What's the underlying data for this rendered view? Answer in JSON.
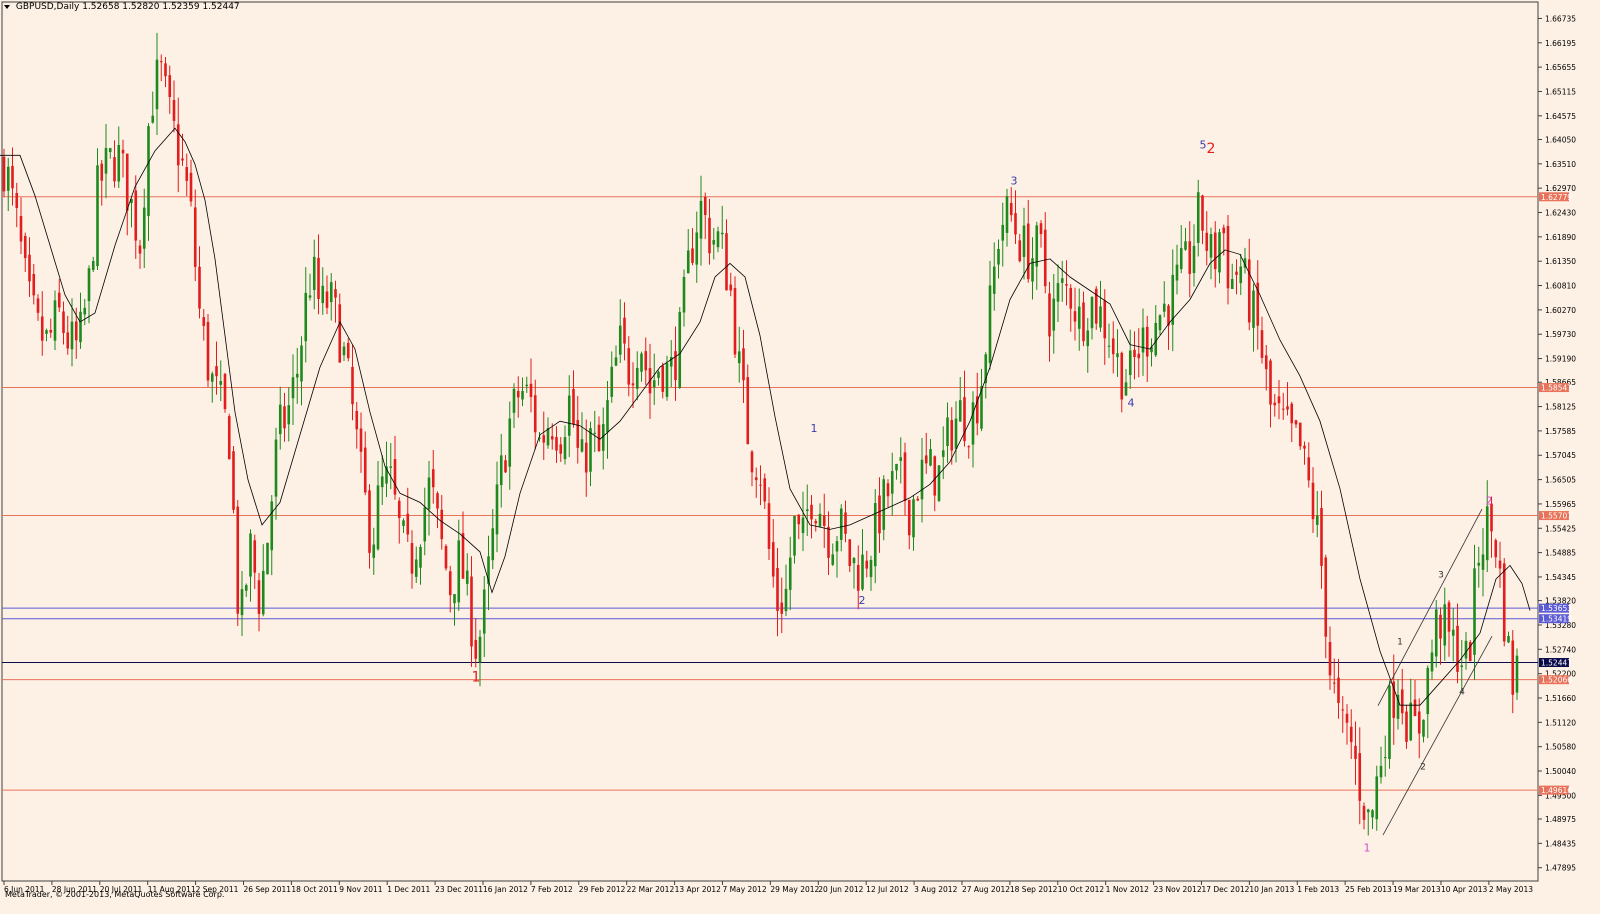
{
  "header": {
    "symbol": "GBPUSD,Daily",
    "ohlc": "1.52658 1.52820 1.52359 1.52447"
  },
  "footer": {
    "copyright": "MetaTrader, © 2001-2013, MetaQuotes Software Corp."
  },
  "colors": {
    "background": "#fdf0e4",
    "bull": "#1e8a1e",
    "bear": "#e11d1d",
    "level_line": "#e8735a",
    "channel_line": "#5b5bd6",
    "ma": "#000000",
    "wave_red": "#e11d1d",
    "wave_blue": "#3b3bb0",
    "wave_magenta": "#d34fd3"
  },
  "chart_data": {
    "type": "candlestick",
    "symbol": "GBPUSD",
    "timeframe": "Daily",
    "y_range": [
      1.476,
      1.671
    ],
    "y_ticks": [
      "1.66735",
      "1.66195",
      "1.65655",
      "1.65115",
      "1.64575",
      "1.64050",
      "1.63510",
      "1.62970",
      "1.62430",
      "1.61890",
      "1.61350",
      "1.60810",
      "1.60270",
      "1.59730",
      "1.59190",
      "1.58665",
      "1.58125",
      "1.57585",
      "1.57045",
      "1.56505",
      "1.55965",
      "1.55425",
      "1.54885",
      "1.54345",
      "1.53820",
      "1.53280",
      "1.52740",
      "1.52200",
      "1.51660",
      "1.51120",
      "1.50580",
      "1.50040",
      "1.49500",
      "1.48975",
      "1.48435",
      "1.47895"
    ],
    "x_ticks": [
      "6 Jun 2011",
      "28 Jun 2011",
      "20 Jul 2011",
      "11 Aug 2011",
      "2 Sep 2011",
      "26 Sep 2011",
      "18 Oct 2011",
      "9 Nov 2011",
      "1 Dec 2011",
      "23 Dec 2011",
      "16 Jan 2012",
      "7 Feb 2012",
      "29 Feb 2012",
      "22 Mar 2012",
      "13 Apr 2012",
      "7 May 2012",
      "29 May 2012",
      "20 Jun 2012",
      "12 Jul 2012",
      "3 Aug 2012",
      "27 Aug 2012",
      "18 Sep 2012",
      "10 Oct 2012",
      "1 Nov 2012",
      "23 Nov 2012",
      "17 Dec 2012",
      "10 Jan 2013",
      "1 Feb 2013",
      "25 Feb 2013",
      "19 Mar 2013",
      "10 Apr 2013",
      "2 May 2013"
    ],
    "close_path": [
      [
        0,
        1.638
      ],
      [
        8,
        1.632
      ],
      [
        18,
        1.62
      ],
      [
        28,
        1.605
      ],
      [
        38,
        1.598
      ],
      [
        48,
        1.595
      ],
      [
        58,
        1.602
      ],
      [
        68,
        1.596
      ],
      [
        78,
        1.594
      ],
      [
        88,
        1.606
      ],
      [
        98,
        1.63
      ],
      [
        108,
        1.635
      ],
      [
        118,
        1.637
      ],
      [
        130,
        1.627
      ],
      [
        140,
        1.618
      ],
      [
        150,
        1.648
      ],
      [
        160,
        1.656
      ],
      [
        170,
        1.645
      ],
      [
        180,
        1.637
      ],
      [
        190,
        1.626
      ],
      [
        200,
        1.601
      ],
      [
        210,
        1.588
      ],
      [
        220,
        1.582
      ],
      [
        230,
        1.574
      ],
      [
        236,
        1.545
      ],
      [
        240,
        1.531
      ],
      [
        250,
        1.55
      ],
      [
        260,
        1.538
      ],
      [
        268,
        1.553
      ],
      [
        278,
        1.575
      ],
      [
        288,
        1.58
      ],
      [
        298,
        1.59
      ],
      [
        305,
        1.603
      ],
      [
        312,
        1.612
      ],
      [
        320,
        1.603
      ],
      [
        330,
        1.605
      ],
      [
        338,
        1.599
      ],
      [
        346,
        1.59
      ],
      [
        354,
        1.578
      ],
      [
        362,
        1.564
      ],
      [
        372,
        1.551
      ],
      [
        380,
        1.563
      ],
      [
        390,
        1.565
      ],
      [
        400,
        1.553
      ],
      [
        410,
        1.546
      ],
      [
        420,
        1.555
      ],
      [
        430,
        1.564
      ],
      [
        440,
        1.552
      ],
      [
        450,
        1.541
      ],
      [
        460,
        1.548
      ],
      [
        468,
        1.538
      ],
      [
        476,
        1.528
      ],
      [
        482,
        1.532
      ],
      [
        490,
        1.547
      ],
      [
        500,
        1.565
      ],
      [
        510,
        1.578
      ],
      [
        520,
        1.585
      ],
      [
        530,
        1.583
      ],
      [
        540,
        1.573
      ],
      [
        550,
        1.579
      ],
      [
        560,
        1.575
      ],
      [
        570,
        1.583
      ],
      [
        580,
        1.567
      ],
      [
        590,
        1.574
      ],
      [
        600,
        1.57
      ],
      [
        610,
        1.584
      ],
      [
        620,
        1.595
      ],
      [
        630,
        1.589
      ],
      [
        640,
        1.597
      ],
      [
        650,
        1.585
      ],
      [
        660,
        1.591
      ],
      [
        670,
        1.588
      ],
      [
        680,
        1.597
      ],
      [
        690,
        1.615
      ],
      [
        700,
        1.626
      ],
      [
        710,
        1.619
      ],
      [
        720,
        1.618
      ],
      [
        730,
        1.608
      ],
      [
        740,
        1.588
      ],
      [
        750,
        1.572
      ],
      [
        760,
        1.568
      ],
      [
        770,
        1.547
      ],
      [
        778,
        1.537
      ],
      [
        786,
        1.54
      ],
      [
        794,
        1.555
      ],
      [
        802,
        1.55
      ],
      [
        810,
        1.562
      ],
      [
        820,
        1.559
      ],
      [
        830,
        1.552
      ],
      [
        840,
        1.555
      ],
      [
        850,
        1.547
      ],
      [
        860,
        1.545
      ],
      [
        870,
        1.55
      ],
      [
        880,
        1.558
      ],
      [
        890,
        1.563
      ],
      [
        900,
        1.565
      ],
      [
        910,
        1.558
      ],
      [
        920,
        1.566
      ],
      [
        930,
        1.567
      ],
      [
        940,
        1.566
      ],
      [
        950,
        1.576
      ],
      [
        960,
        1.58
      ],
      [
        970,
        1.578
      ],
      [
        980,
        1.585
      ],
      [
        990,
        1.603
      ],
      [
        1000,
        1.622
      ],
      [
        1010,
        1.624
      ],
      [
        1020,
        1.618
      ],
      [
        1030,
        1.614
      ],
      [
        1040,
        1.617
      ],
      [
        1050,
        1.601
      ],
      [
        1060,
        1.607
      ],
      [
        1070,
        1.607
      ],
      [
        1080,
        1.6
      ],
      [
        1090,
        1.605
      ],
      [
        1100,
        1.602
      ],
      [
        1110,
        1.597
      ],
      [
        1120,
        1.589
      ],
      [
        1130,
        1.588
      ],
      [
        1140,
        1.595
      ],
      [
        1150,
        1.598
      ],
      [
        1160,
        1.602
      ],
      [
        1170,
        1.605
      ],
      [
        1180,
        1.61
      ],
      [
        1190,
        1.614
      ],
      [
        1200,
        1.625
      ],
      [
        1206,
        1.618
      ],
      [
        1214,
        1.613
      ],
      [
        1222,
        1.623
      ],
      [
        1230,
        1.608
      ],
      [
        1240,
        1.613
      ],
      [
        1250,
        1.604
      ],
      [
        1260,
        1.596
      ],
      [
        1270,
        1.581
      ],
      [
        1280,
        1.578
      ],
      [
        1290,
        1.575
      ],
      [
        1300,
        1.572
      ],
      [
        1310,
        1.562
      ],
      [
        1320,
        1.55
      ],
      [
        1330,
        1.523
      ],
      [
        1340,
        1.51
      ],
      [
        1350,
        1.508
      ],
      [
        1360,
        1.497
      ],
      [
        1370,
        1.488
      ],
      [
        1378,
        1.5
      ],
      [
        1388,
        1.513
      ],
      [
        1398,
        1.521
      ],
      [
        1408,
        1.511
      ],
      [
        1418,
        1.509
      ],
      [
        1428,
        1.522
      ],
      [
        1438,
        1.535
      ],
      [
        1448,
        1.53
      ],
      [
        1458,
        1.527
      ],
      [
        1468,
        1.524
      ],
      [
        1478,
        1.548
      ],
      [
        1488,
        1.556
      ],
      [
        1496,
        1.551
      ],
      [
        1504,
        1.535
      ],
      [
        1512,
        1.52
      ],
      [
        1518,
        1.524
      ]
    ],
    "moving_average_path": [
      [
        0,
        1.637
      ],
      [
        20,
        1.637
      ],
      [
        35,
        1.628
      ],
      [
        50,
        1.617
      ],
      [
        65,
        1.606
      ],
      [
        80,
        1.6
      ],
      [
        95,
        1.602
      ],
      [
        115,
        1.617
      ],
      [
        135,
        1.63
      ],
      [
        155,
        1.638
      ],
      [
        175,
        1.643
      ],
      [
        185,
        1.64
      ],
      [
        195,
        1.635
      ],
      [
        205,
        1.627
      ],
      [
        215,
        1.614
      ],
      [
        225,
        1.597
      ],
      [
        235,
        1.58
      ],
      [
        248,
        1.565
      ],
      [
        262,
        1.555
      ],
      [
        280,
        1.56
      ],
      [
        300,
        1.575
      ],
      [
        320,
        1.59
      ],
      [
        340,
        1.6
      ],
      [
        355,
        1.594
      ],
      [
        370,
        1.58
      ],
      [
        385,
        1.568
      ],
      [
        400,
        1.562
      ],
      [
        420,
        1.56
      ],
      [
        440,
        1.556
      ],
      [
        460,
        1.553
      ],
      [
        480,
        1.549
      ],
      [
        492,
        1.54
      ],
      [
        505,
        1.548
      ],
      [
        520,
        1.562
      ],
      [
        540,
        1.575
      ],
      [
        560,
        1.578
      ],
      [
        580,
        1.577
      ],
      [
        600,
        1.574
      ],
      [
        620,
        1.578
      ],
      [
        640,
        1.584
      ],
      [
        660,
        1.59
      ],
      [
        680,
        1.593
      ],
      [
        700,
        1.6
      ],
      [
        715,
        1.61
      ],
      [
        730,
        1.613
      ],
      [
        745,
        1.61
      ],
      [
        760,
        1.597
      ],
      [
        775,
        1.579
      ],
      [
        790,
        1.563
      ],
      [
        810,
        1.555
      ],
      [
        830,
        1.554
      ],
      [
        850,
        1.555
      ],
      [
        870,
        1.557
      ],
      [
        890,
        1.559
      ],
      [
        910,
        1.561
      ],
      [
        930,
        1.564
      ],
      [
        950,
        1.569
      ],
      [
        970,
        1.578
      ],
      [
        990,
        1.59
      ],
      [
        1010,
        1.605
      ],
      [
        1030,
        1.613
      ],
      [
        1050,
        1.614
      ],
      [
        1070,
        1.61
      ],
      [
        1090,
        1.607
      ],
      [
        1110,
        1.604
      ],
      [
        1130,
        1.595
      ],
      [
        1150,
        1.594
      ],
      [
        1170,
        1.6
      ],
      [
        1190,
        1.605
      ],
      [
        1210,
        1.613
      ],
      [
        1225,
        1.616
      ],
      [
        1240,
        1.615
      ],
      [
        1260,
        1.606
      ],
      [
        1280,
        1.596
      ],
      [
        1300,
        1.588
      ],
      [
        1320,
        1.578
      ],
      [
        1340,
        1.563
      ],
      [
        1360,
        1.543
      ],
      [
        1380,
        1.527
      ],
      [
        1400,
        1.515
      ],
      [
        1420,
        1.515
      ],
      [
        1440,
        1.52
      ],
      [
        1460,
        1.525
      ],
      [
        1480,
        1.531
      ],
      [
        1496,
        1.543
      ],
      [
        1510,
        1.546
      ],
      [
        1522,
        1.542
      ],
      [
        1530,
        1.536
      ]
    ],
    "horizontal_levels": [
      {
        "price": 1.62779,
        "label": "1.62779",
        "color": "#e8735a"
      },
      {
        "price": 1.58547,
        "label": "1.58547",
        "color": "#e8735a"
      },
      {
        "price": 1.55707,
        "label": "1.55707",
        "color": "#e8735a"
      },
      {
        "price": 1.53653,
        "label": "1.53653",
        "color": "#5b5bd6"
      },
      {
        "price": 1.53419,
        "label": "1.53419",
        "color": "#5b5bd6"
      },
      {
        "price": 1.52447,
        "label": "1.52447",
        "color": "#0a0a4a"
      },
      {
        "price": 1.52066,
        "label": "1.52066",
        "color": "#e8735a"
      },
      {
        "price": 1.49616,
        "label": "1.49616",
        "color": "#e8735a"
      }
    ],
    "wave_labels": [
      {
        "text": "1",
        "x": 476,
        "price": 1.5203,
        "color": "#e11d1d",
        "size": "large"
      },
      {
        "text": "2",
        "x": 1211,
        "price": 1.6375,
        "color": "#e11d1d",
        "size": "large"
      },
      {
        "text": "5",
        "x": 1203,
        "price": 1.6385,
        "color": "#3b3bb0",
        "size": "small"
      },
      {
        "text": "3",
        "x": 1014,
        "price": 1.6305,
        "color": "#3b3bb0",
        "size": "small"
      },
      {
        "text": "4",
        "x": 1131,
        "price": 1.5813,
        "color": "#3b3bb0",
        "size": "small"
      },
      {
        "text": "1",
        "x": 814,
        "price": 1.5756,
        "color": "#3b3bb0",
        "size": "small"
      },
      {
        "text": "2",
        "x": 862,
        "price": 1.5375,
        "color": "#3b3bb0",
        "size": "small"
      },
      {
        "text": "1",
        "x": 1367,
        "price": 1.4825,
        "color": "#d34fd3",
        "size": "small"
      },
      {
        "text": "2",
        "x": 1489,
        "price": 1.5595,
        "color": "#d34fd3",
        "size": "small"
      },
      {
        "text": "1",
        "x": 1400,
        "price": 1.5285,
        "color": "#333333",
        "size": "tiny"
      },
      {
        "text": "2",
        "x": 1423,
        "price": 1.5007,
        "color": "#333333",
        "size": "tiny"
      },
      {
        "text": "3",
        "x": 1441,
        "price": 1.5433,
        "color": "#333333",
        "size": "tiny"
      },
      {
        "text": "4",
        "x": 1462,
        "price": 1.5174,
        "color": "#333333",
        "size": "tiny"
      }
    ],
    "channel_lines": [
      {
        "from": [
          1378,
          1.5149
        ],
        "to": [
          1482,
          1.5585
        ]
      },
      {
        "from": [
          1383,
          1.4862
        ],
        "to": [
          1492,
          1.5303
        ]
      }
    ]
  }
}
